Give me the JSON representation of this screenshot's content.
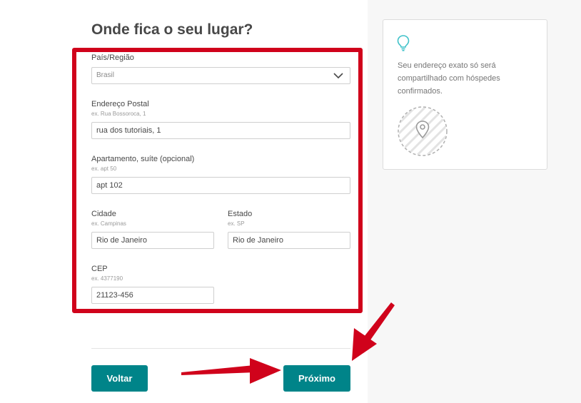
{
  "page": {
    "title": "Onde fica o seu lugar?"
  },
  "form": {
    "country": {
      "label": "País/Região",
      "value": "Brasil"
    },
    "street": {
      "label": "Endereço Postal",
      "hint": "ex. Rua Bossoroca, 1",
      "value": "rua dos tutoriais, 1"
    },
    "apartment": {
      "label": "Apartamento, suíte (opcional)",
      "hint": "ex. apt 50",
      "value": "apt 102"
    },
    "city": {
      "label": "Cidade",
      "hint": "ex. Campinas",
      "value": "Rio de Janeiro"
    },
    "state": {
      "label": "Estado",
      "hint": "ex. SP",
      "value": "Rio de Janeiro"
    },
    "zip": {
      "label": "CEP",
      "hint": "ex. 4377190",
      "value": "21123-456"
    }
  },
  "actions": {
    "back_label": "Voltar",
    "next_label": "Próximo"
  },
  "tip": {
    "text": "Seu endereço exato só será compartilhado com hóspedes confirmados."
  },
  "colors": {
    "accent": "#008489",
    "highlight": "#d0021b",
    "sidebar_bg": "#f7f7f7"
  },
  "icons": {
    "tip": "lightbulb-icon",
    "map": "map-pin-icon",
    "select": "chevron-down-icon"
  }
}
